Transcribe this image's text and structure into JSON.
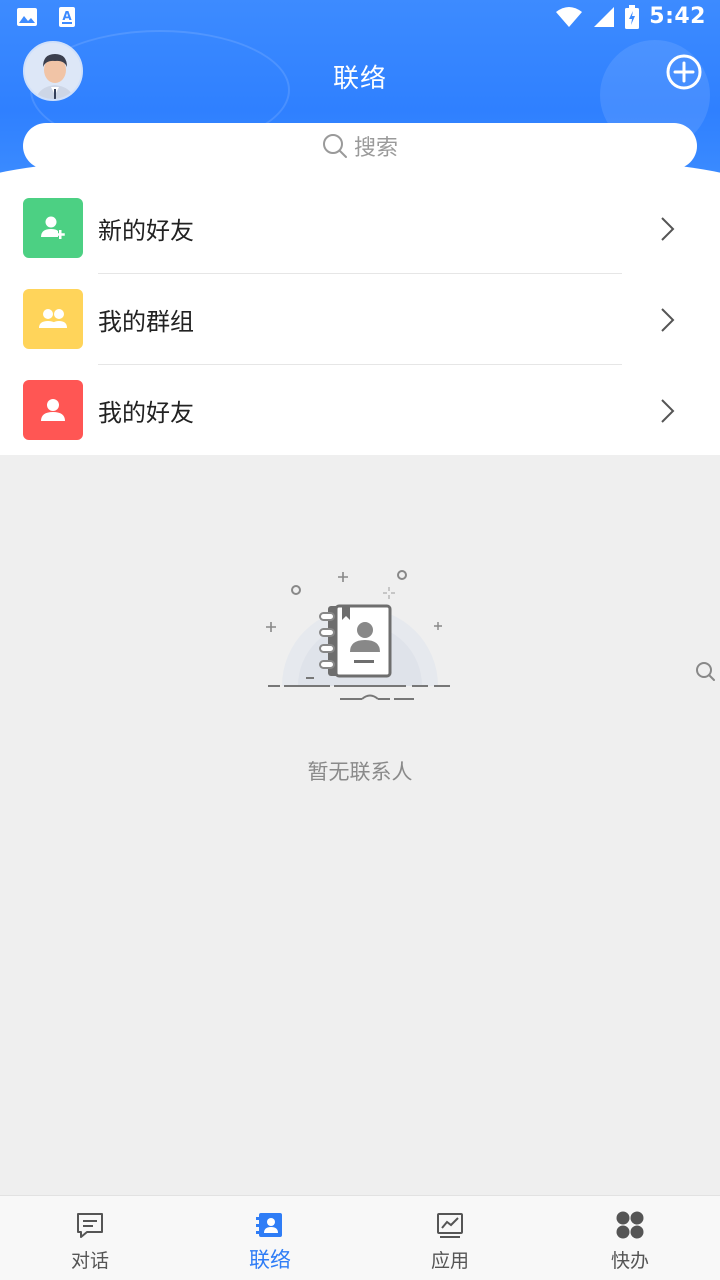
{
  "status_bar": {
    "time": "5:42"
  },
  "header": {
    "title": "联络",
    "search_placeholder": "搜索"
  },
  "menu": [
    {
      "label": "新的好友",
      "icon": "add-user-icon",
      "color": "#4cd083"
    },
    {
      "label": "我的群组",
      "icon": "group-icon",
      "color": "#ffd45a"
    },
    {
      "label": "我的好友",
      "icon": "user-icon",
      "color": "#ff5654"
    }
  ],
  "empty_state": {
    "text": "暂无联系人",
    "icon": "contact-book-icon"
  },
  "bottom_nav": [
    {
      "label": "对话",
      "icon": "chat-icon",
      "active": false
    },
    {
      "label": "联络",
      "icon": "contacts-icon",
      "active": true
    },
    {
      "label": "应用",
      "icon": "chart-icon",
      "active": false
    },
    {
      "label": "快办",
      "icon": "grid-icon",
      "active": false
    }
  ],
  "colors": {
    "primary": "#2f80ff",
    "active_tab": "#2f7df6"
  }
}
